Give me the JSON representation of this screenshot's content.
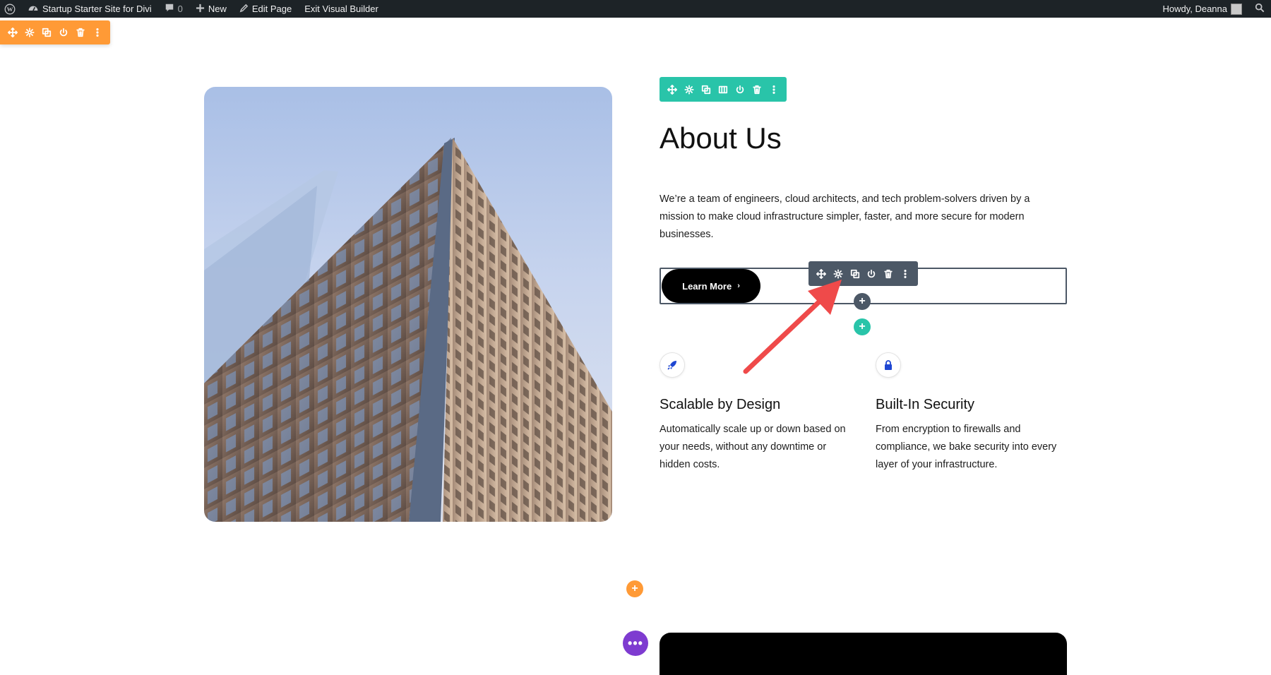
{
  "adminbar": {
    "site_name": "Startup Starter Site for Divi",
    "comments_count": "0",
    "new_label": "New",
    "edit_page_label": "Edit Page",
    "exit_builder_label": "Exit Visual Builder",
    "greeting": "Howdy, Deanna"
  },
  "about": {
    "title": "About Us",
    "text": "We’re a team of engineers, cloud architects, and tech problem-solvers driven by a mission to make cloud infrastructure simpler, faster, and more secure for modern businesses.",
    "button_label": "Learn More",
    "button_chevron": "›"
  },
  "features": [
    {
      "icon": "rocket-icon",
      "title": "Scalable by Design",
      "text": "Automatically scale up or down based on your needs, without any downtime or hidden costs."
    },
    {
      "icon": "lock-icon",
      "title": "Built-In Security",
      "text": "From encryption to firewalls and compliance, we bake security into every layer of your infrastructure."
    }
  ],
  "builder": {
    "plus": "+",
    "dots": "•••"
  },
  "colors": {
    "section_toolbar": "#ff9a36",
    "row_toolbar": "#29c4a9",
    "module_toolbar": "#4c5866",
    "purple": "#7e3bd0",
    "annotation_arrow": "#ef4a4a",
    "feature_icon": "#1e46d2"
  }
}
